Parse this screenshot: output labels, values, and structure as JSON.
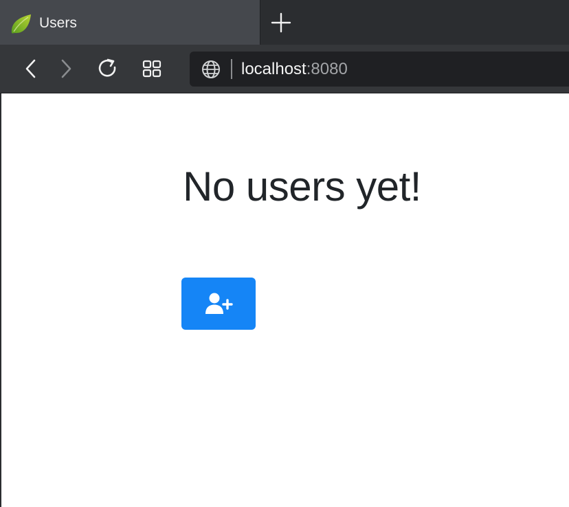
{
  "tab": {
    "title": "Users",
    "favicon": "spring-leaf-icon"
  },
  "toolbar": {
    "back_icon": "chevron-left-icon",
    "forward_icon": "chevron-right-icon",
    "reload_icon": "reload-icon",
    "tabs_icon": "grid-icon"
  },
  "address": {
    "host": "localhost",
    "port": ":8080",
    "icon": "globe-icon"
  },
  "page": {
    "heading": "No users yet!",
    "add_button_icon": "user-plus-icon"
  },
  "colors": {
    "tab_active": "#45484d",
    "tabstrip": "#2b2d30",
    "toolbar": "#35373a",
    "addressbar": "#1f2023",
    "primary_button": "#1585f6",
    "heading_text": "#212529"
  }
}
